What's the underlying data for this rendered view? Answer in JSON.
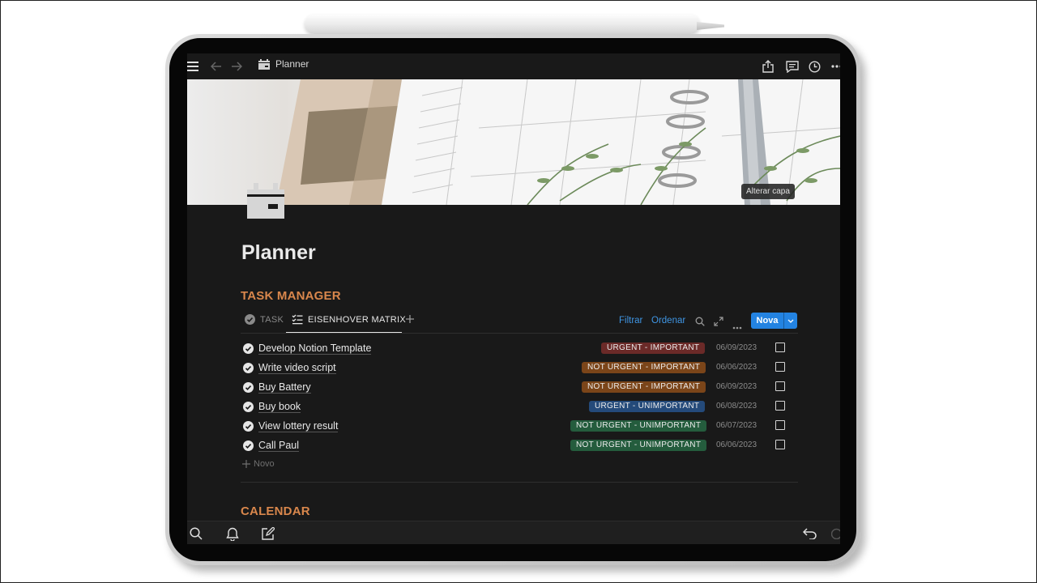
{
  "topbar": {
    "page_name": "Planner",
    "icons": [
      "menu-icon",
      "back-arrow-icon",
      "forward-arrow-icon",
      "share-icon",
      "comment-icon",
      "history-icon",
      "more-icon"
    ]
  },
  "cover": {
    "change_cover_label": "Alterar capa"
  },
  "page": {
    "title": "Planner"
  },
  "task_manager": {
    "heading": "TASK MANAGER",
    "tabs": [
      {
        "label": "TASK",
        "active": false
      },
      {
        "label": "EISENHOVER MATRIX",
        "active": true
      }
    ],
    "toolbar": {
      "filter_label": "Filtrar",
      "sort_label": "Ordenar",
      "new_label": "Nova"
    },
    "rows": [
      {
        "name": "Develop Notion Template",
        "tag": "URGENT - IMPORTANT",
        "tag_color": "#6b2a28",
        "date": "06/09/2023",
        "checked": false
      },
      {
        "name": "Write video script",
        "tag": "NOT URGENT - IMPORTANT",
        "tag_color": "#7b4519",
        "date": "06/06/2023",
        "checked": false
      },
      {
        "name": "Buy Battery",
        "tag": "NOT URGENT - IMPORTANT",
        "tag_color": "#7b4519",
        "date": "06/09/2023",
        "checked": false
      },
      {
        "name": "Buy book",
        "tag": "URGENT - UNIMPORTANT",
        "tag_color": "#244a7a",
        "date": "06/08/2023",
        "checked": false
      },
      {
        "name": "View lottery result",
        "tag": "NOT URGENT - UNIMPORTANT",
        "tag_color": "#245c3d",
        "date": "06/07/2023",
        "checked": false
      },
      {
        "name": "Call Paul",
        "tag": "NOT URGENT - UNIMPORTANT",
        "tag_color": "#245c3d",
        "date": "06/06/2023",
        "checked": false
      }
    ],
    "add_new_label": "Novo"
  },
  "calendar": {
    "heading": "CALENDAR"
  },
  "bottombar": {
    "icons": [
      "search-icon",
      "bell-icon",
      "compose-icon",
      "undo-icon",
      "redo-icon"
    ]
  },
  "colors": {
    "accent_orange": "#d9874c",
    "link_blue": "#3f95e3",
    "button_blue": "#2383e2",
    "background": "#191919"
  }
}
